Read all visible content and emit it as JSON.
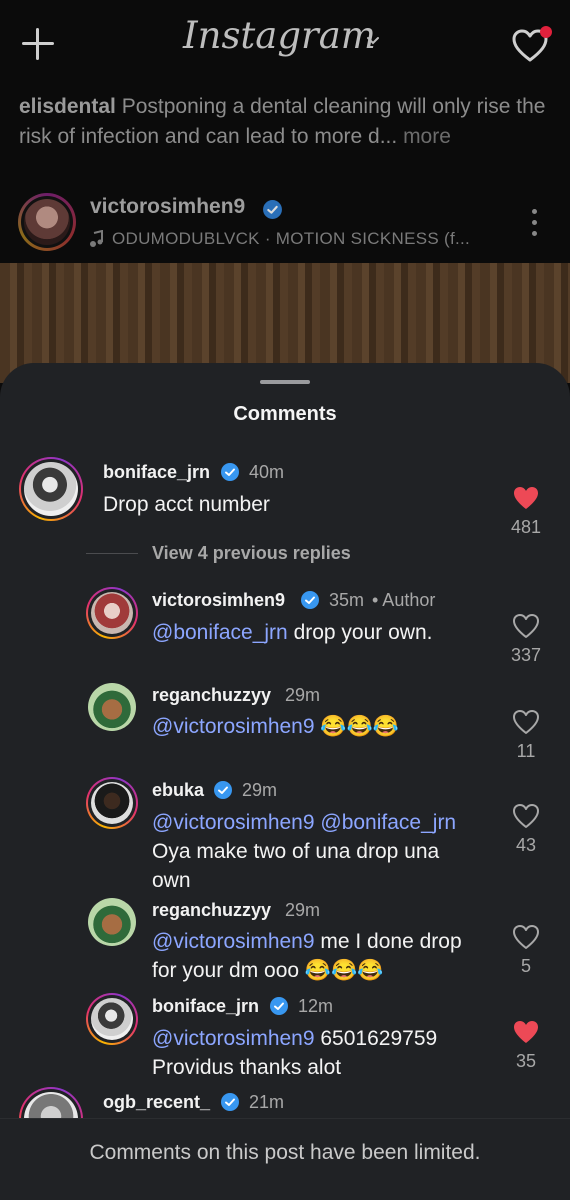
{
  "app": {
    "logo_text": "Instagram",
    "accent_blue": "#3897f0",
    "like_red": "#ed4956",
    "notification_dot": "#e0213c"
  },
  "feed": {
    "caption_user": "elisdental",
    "caption_text": "Postponing a dental cleaning will only rise the risk of infection and can lead to more d...",
    "caption_more": "more",
    "post_user": "victorosimhen9",
    "post_music": "ODUMODUBLVCK · MOTION SICKNESS (f..."
  },
  "comments_sheet": {
    "title": "Comments",
    "view_replies": "View 4 previous replies",
    "footer": "Comments on this post have been limited.",
    "comments": [
      {
        "user": "boniface_jrn",
        "verified": true,
        "time": "40m",
        "text": "Drop acct number",
        "likes": "481",
        "liked": true
      },
      {
        "user": "victorosimhen9",
        "verified": true,
        "time": "35m",
        "author_label": "• Author",
        "mention": "@boniface_jrn",
        "text": " drop your own.",
        "likes": "337",
        "liked": false
      },
      {
        "user": "reganchuzzyy",
        "verified": false,
        "time": "29m",
        "mention": "@victorosimhen9",
        "text": " 😂😂😂",
        "likes": "11",
        "liked": false
      },
      {
        "user": "ebuka",
        "verified": true,
        "time": "29m",
        "mention": "@victorosimhen9 @boniface_jrn",
        "text": "Oya make two of una drop una own",
        "likes": "43",
        "liked": false
      },
      {
        "user": "reganchuzzyy",
        "verified": false,
        "time": "29m",
        "mention": "@victorosimhen9",
        "text": " me I done drop for your dm ooo 😂😂😂",
        "likes": "5",
        "liked": false
      },
      {
        "user": "boniface_jrn",
        "verified": true,
        "time": "12m",
        "mention": "@victorosimhen9",
        "text": " 6501629759 Providus thanks alot",
        "likes": "35",
        "liked": true
      },
      {
        "user": "ogb_recent_",
        "verified": true,
        "time": "21m"
      }
    ]
  }
}
